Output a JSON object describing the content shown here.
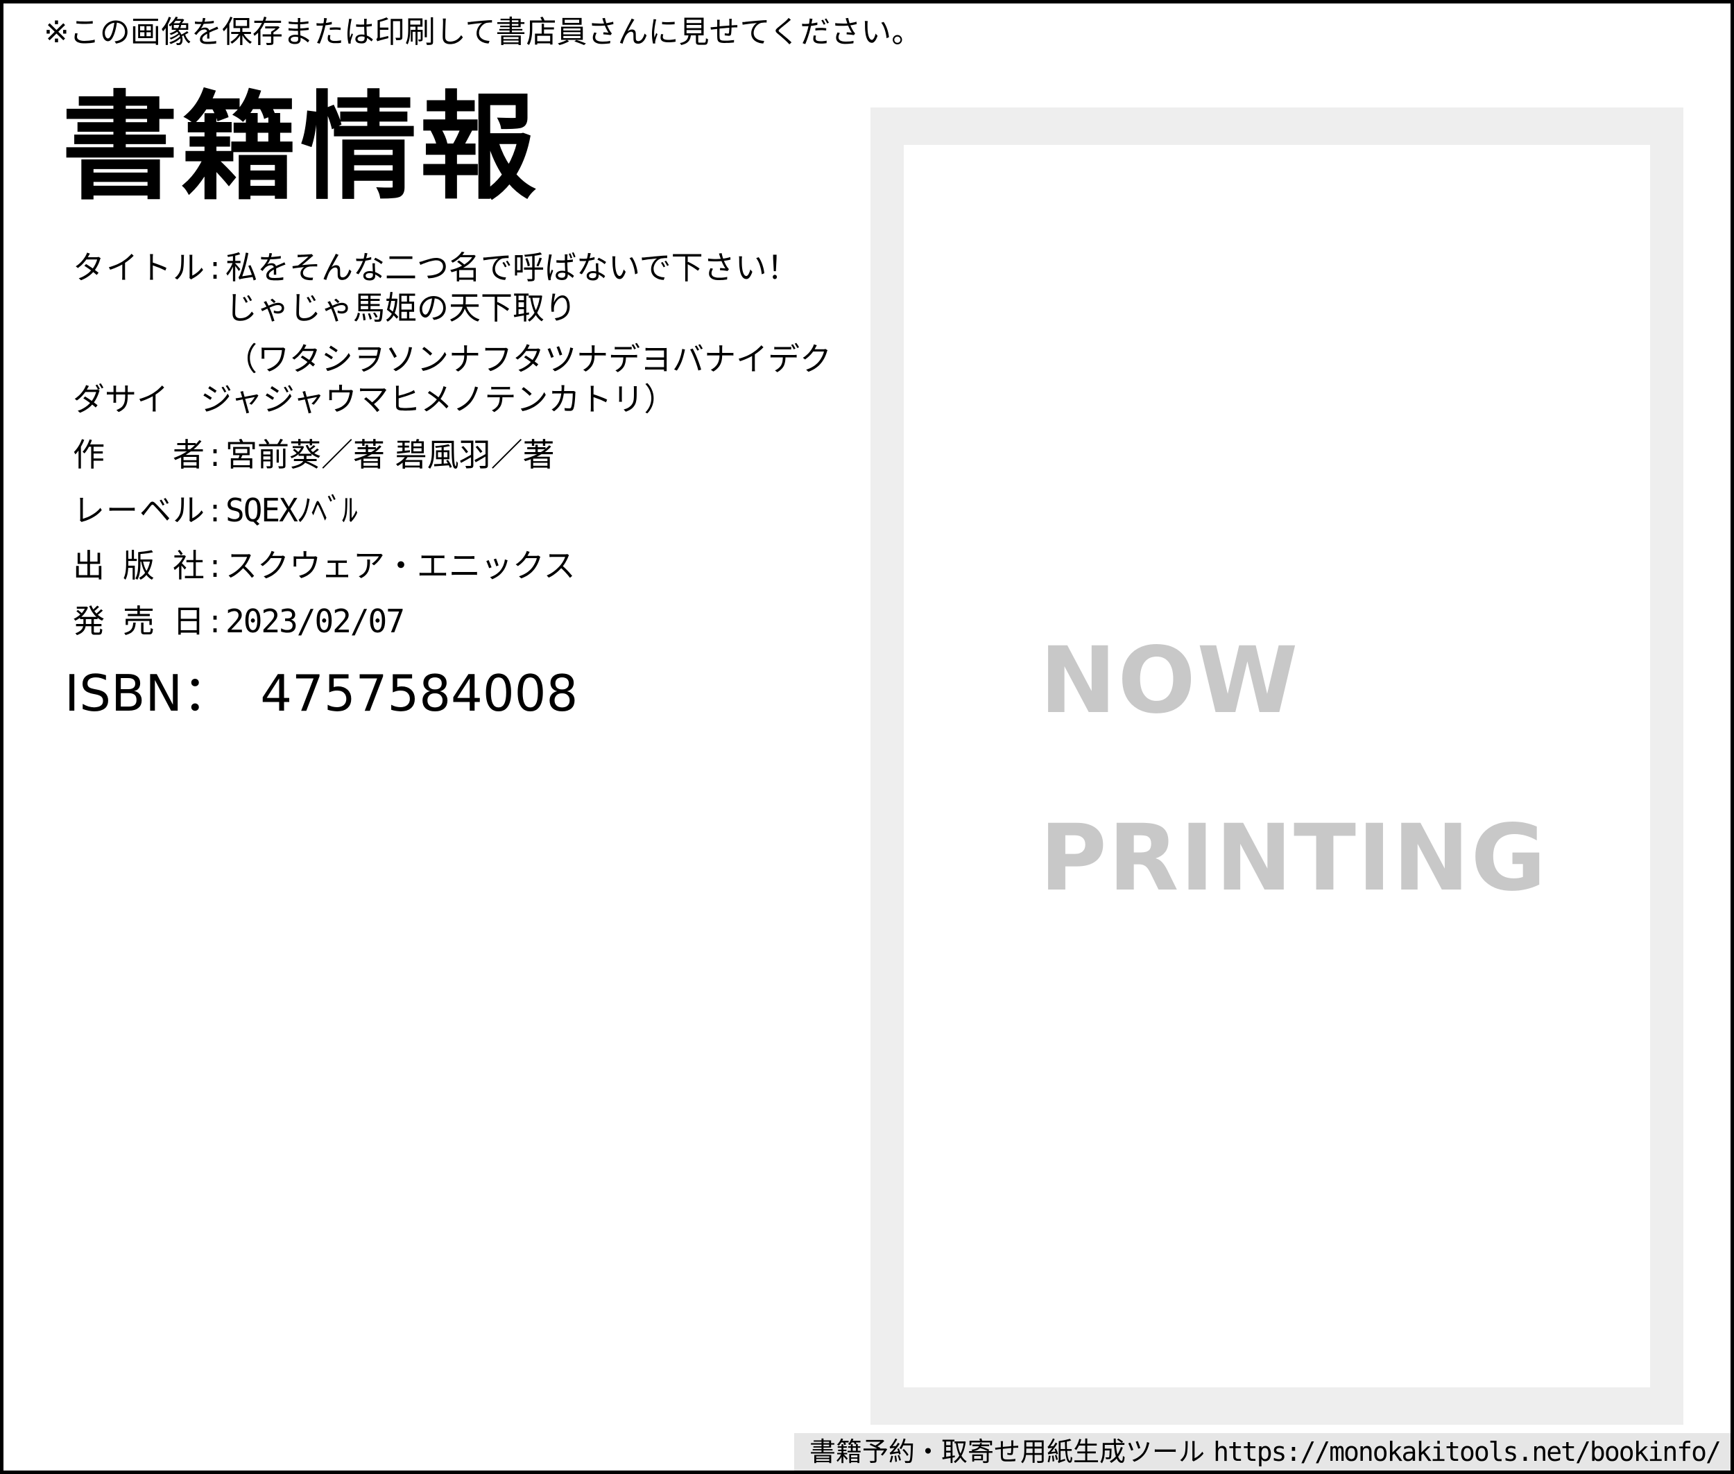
{
  "notice": "※この画像を保存または印刷して書店員さんに見せてください。",
  "heading": "書籍情報",
  "separator": ":",
  "fields": {
    "title": {
      "label_chars": [
        "タ",
        "イ",
        "ト",
        "ル"
      ],
      "value": "私をそんな二つ名で呼ばないで下さい！　じゃじゃ馬姫の天下取り"
    },
    "reading": "（ワタシヲソンナフタツナデヨバナイデクダサイ　ジャジャウマヒメノテンカトリ）",
    "author": {
      "label_chars": [
        "作",
        "者"
      ],
      "value": "宮前葵／著 碧風羽／著"
    },
    "label": {
      "label_chars": [
        "レ",
        "ー",
        "ベ",
        "ル"
      ],
      "value": "SQEXﾉﾍﾞﾙ"
    },
    "publisher": {
      "label_chars": [
        "出",
        "版",
        "社"
      ],
      "value": "スクウェア・エニックス"
    },
    "release_date": {
      "label_chars": [
        "発",
        "売",
        "日"
      ],
      "value": "2023/02/07"
    }
  },
  "isbn": {
    "label": "ISBN：",
    "value": "4757584008"
  },
  "cover": {
    "line1": "NOW",
    "line2": "PRINTING"
  },
  "footer": {
    "text": "書籍予約・取寄せ用紙生成ツール",
    "url": "https://monokakitools.net/bookinfo/"
  }
}
